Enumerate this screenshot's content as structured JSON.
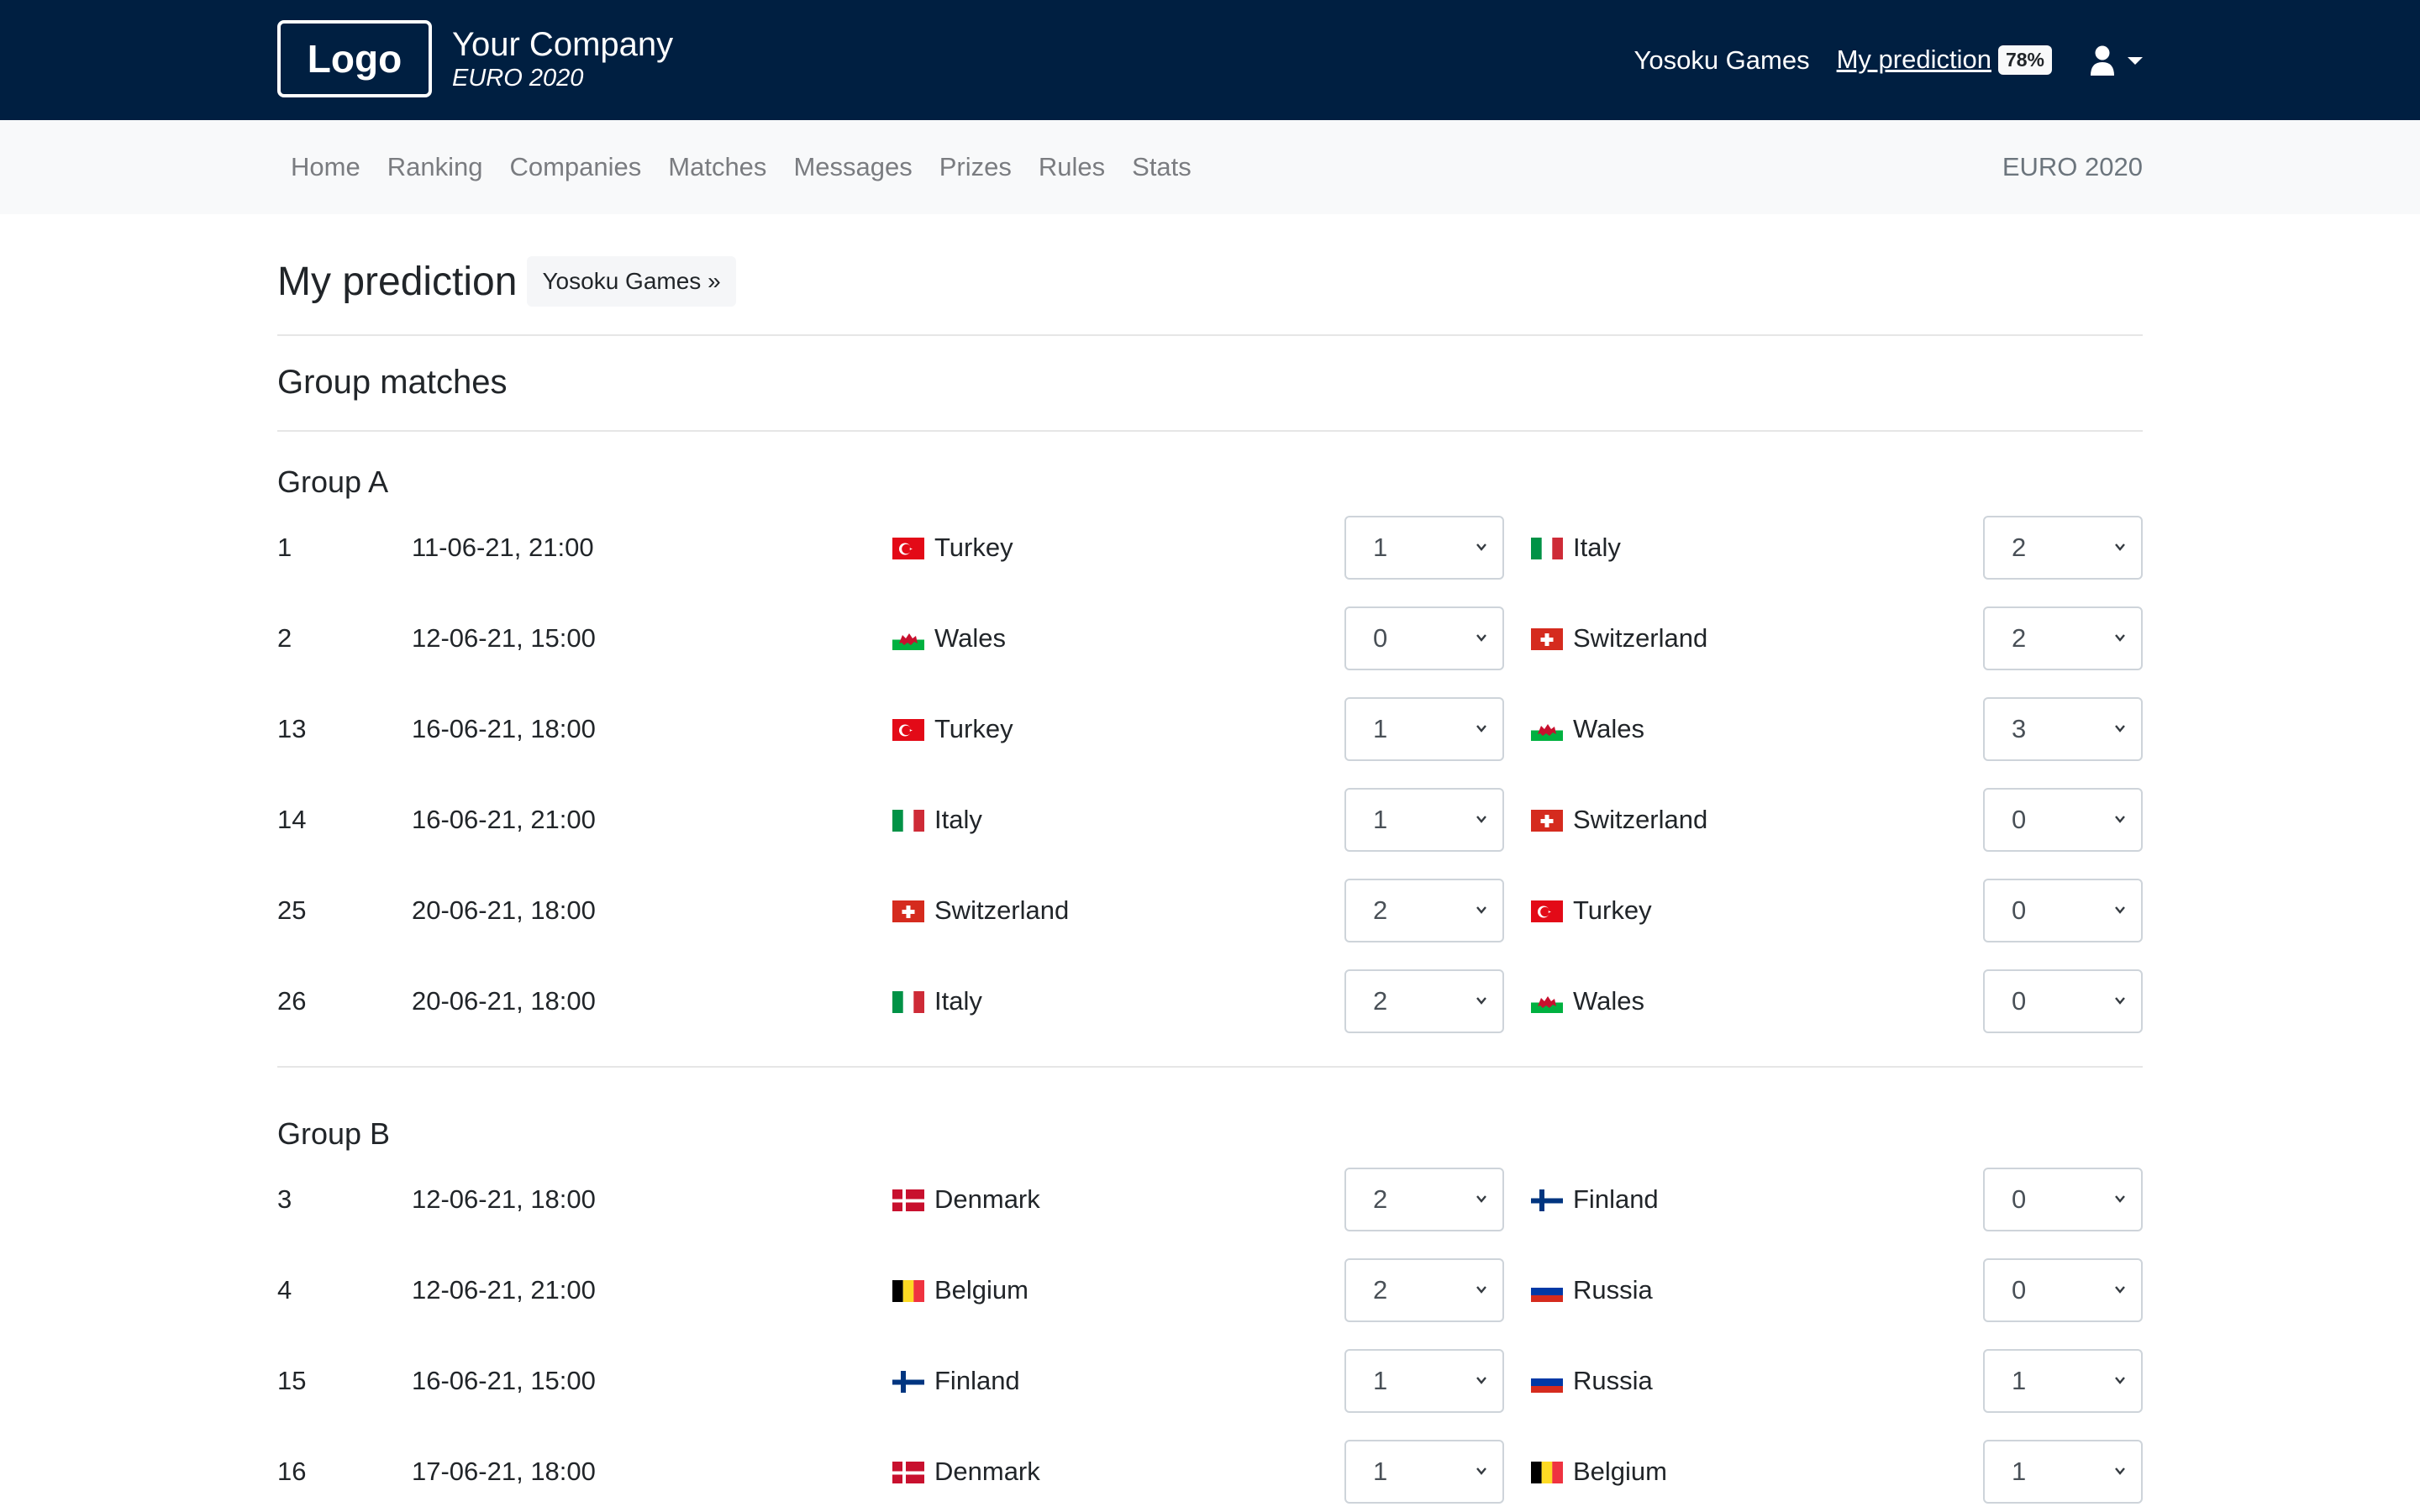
{
  "header": {
    "logo_text": "Logo",
    "company_name": "Your Company",
    "tournament": "EURO 2020",
    "links": {
      "yosoku_games": "Yosoku Games",
      "my_prediction": "My prediction",
      "prediction_progress_badge": "78%"
    },
    "icons": {
      "user": "user-icon",
      "dropdown": "caret-down-icon"
    }
  },
  "subnav": {
    "items": [
      "Home",
      "Ranking",
      "Companies",
      "Matches",
      "Messages",
      "Prizes",
      "Rules",
      "Stats"
    ],
    "right_label": "EURO 2020"
  },
  "page": {
    "title": "My prediction",
    "crumb_button": "Yosoku Games »",
    "section_title": "Group matches"
  },
  "groups": [
    {
      "title": "Group A",
      "matches": [
        {
          "num": "1",
          "datetime": "11-06-21, 21:00",
          "home": "Turkey",
          "home_flag": "turkey",
          "home_score": "1",
          "away": "Italy",
          "away_flag": "italy",
          "away_score": "2"
        },
        {
          "num": "2",
          "datetime": "12-06-21, 15:00",
          "home": "Wales",
          "home_flag": "wales",
          "home_score": "0",
          "away": "Switzerland",
          "away_flag": "switzerland",
          "away_score": "2"
        },
        {
          "num": "13",
          "datetime": "16-06-21, 18:00",
          "home": "Turkey",
          "home_flag": "turkey",
          "home_score": "1",
          "away": "Wales",
          "away_flag": "wales",
          "away_score": "3"
        },
        {
          "num": "14",
          "datetime": "16-06-21, 21:00",
          "home": "Italy",
          "home_flag": "italy",
          "home_score": "1",
          "away": "Switzerland",
          "away_flag": "switzerland",
          "away_score": "0"
        },
        {
          "num": "25",
          "datetime": "20-06-21, 18:00",
          "home": "Switzerland",
          "home_flag": "switzerland",
          "home_score": "2",
          "away": "Turkey",
          "away_flag": "turkey",
          "away_score": "0"
        },
        {
          "num": "26",
          "datetime": "20-06-21, 18:00",
          "home": "Italy",
          "home_flag": "italy",
          "home_score": "2",
          "away": "Wales",
          "away_flag": "wales",
          "away_score": "0"
        }
      ]
    },
    {
      "title": "Group B",
      "matches": [
        {
          "num": "3",
          "datetime": "12-06-21, 18:00",
          "home": "Denmark",
          "home_flag": "denmark",
          "home_score": "2",
          "away": "Finland",
          "away_flag": "finland",
          "away_score": "0"
        },
        {
          "num": "4",
          "datetime": "12-06-21, 21:00",
          "home": "Belgium",
          "home_flag": "belgium",
          "home_score": "2",
          "away": "Russia",
          "away_flag": "russia",
          "away_score": "0"
        },
        {
          "num": "15",
          "datetime": "16-06-21, 15:00",
          "home": "Finland",
          "home_flag": "finland",
          "home_score": "1",
          "away": "Russia",
          "away_flag": "russia",
          "away_score": "1"
        },
        {
          "num": "16",
          "datetime": "17-06-21, 18:00",
          "home": "Denmark",
          "home_flag": "denmark",
          "home_score": "1",
          "away": "Belgium",
          "away_flag": "belgium",
          "away_score": "1"
        }
      ]
    }
  ],
  "colors": {
    "header_bg": "#001f41",
    "subnav_bg": "#f8f9fa",
    "subnav_text": "#7a7c80",
    "text": "#212529"
  }
}
